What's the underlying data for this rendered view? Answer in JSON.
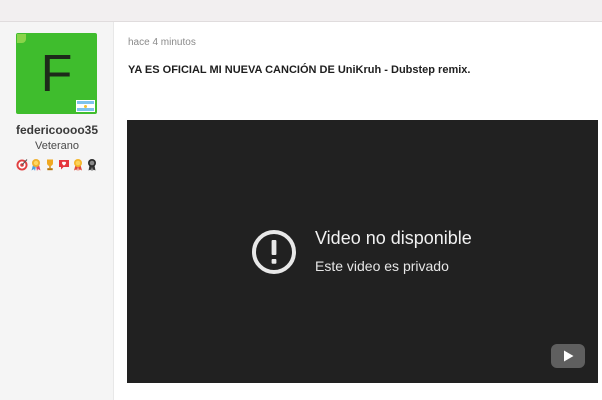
{
  "author": {
    "avatar_letter": "F",
    "avatar_color": "#3fbd2d",
    "online_indicator_color": "#8ad44a",
    "flag_icon": "argentina-flag-icon",
    "username": "federicoooo35",
    "rank": "Veterano",
    "badges": [
      {
        "icon": "target-icon"
      },
      {
        "icon": "ribbon-medal-icon"
      },
      {
        "icon": "trophy-icon"
      },
      {
        "icon": "heart-message-icon"
      },
      {
        "icon": "award-medal-icon"
      },
      {
        "icon": "dark-medal-icon"
      }
    ]
  },
  "post": {
    "timestamp": "hace 4 minutos",
    "title": "YA ES OFICIAL MI NUEVA CANCIÓN DE UniKruh - Dubstep remix."
  },
  "video": {
    "message_title": "Video no disponible",
    "message_subtitle": "Este video es privado",
    "background_color": "#212121",
    "status_icon": "alert-circle-icon",
    "logo_icon": "youtube-logo-icon"
  }
}
